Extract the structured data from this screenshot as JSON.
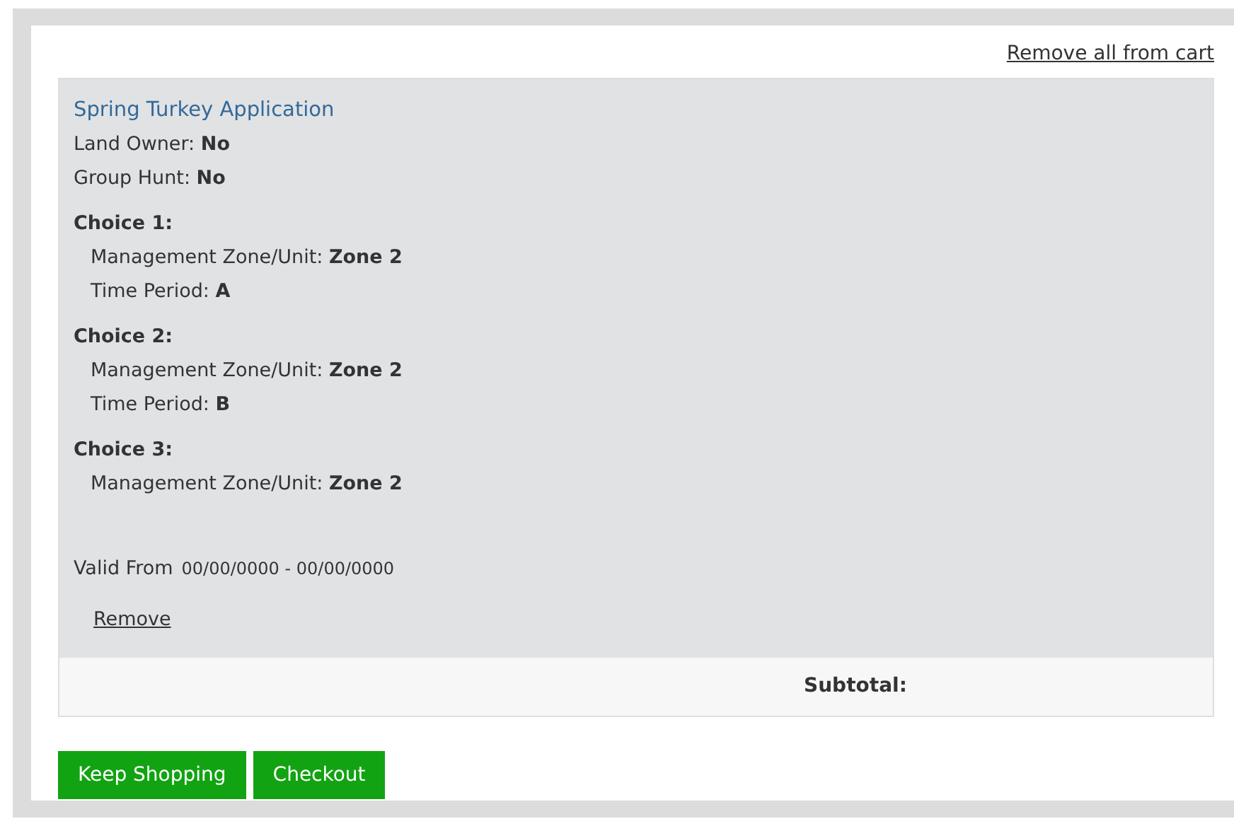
{
  "remove_all_link": "Remove all from cart",
  "item": {
    "title": "Spring Turkey Application",
    "details": [
      "Land Owner: **No**",
      "Group Hunt: **No**"
    ],
    "choices": [
      {
        "heading": "Choice 1:",
        "lines": [
          "Management Zone/Unit: **Zone 2**",
          "Time Period: **A**"
        ]
      },
      {
        "heading": "Choice 2:",
        "lines": [
          "Management Zone/Unit: **Zone 2**",
          "Time Period: **B**"
        ]
      },
      {
        "heading": "Choice 3:",
        "lines": [
          "Management Zone/Unit: **Zone 2**"
        ]
      }
    ],
    "valid_label": "Valid From",
    "valid_dates": "00/00/0000 - 00/00/0000",
    "remove_link": "Remove"
  },
  "subtotal_label": "Subtotal:",
  "buttons": [
    "Keep Shopping",
    "Checkout"
  ]
}
